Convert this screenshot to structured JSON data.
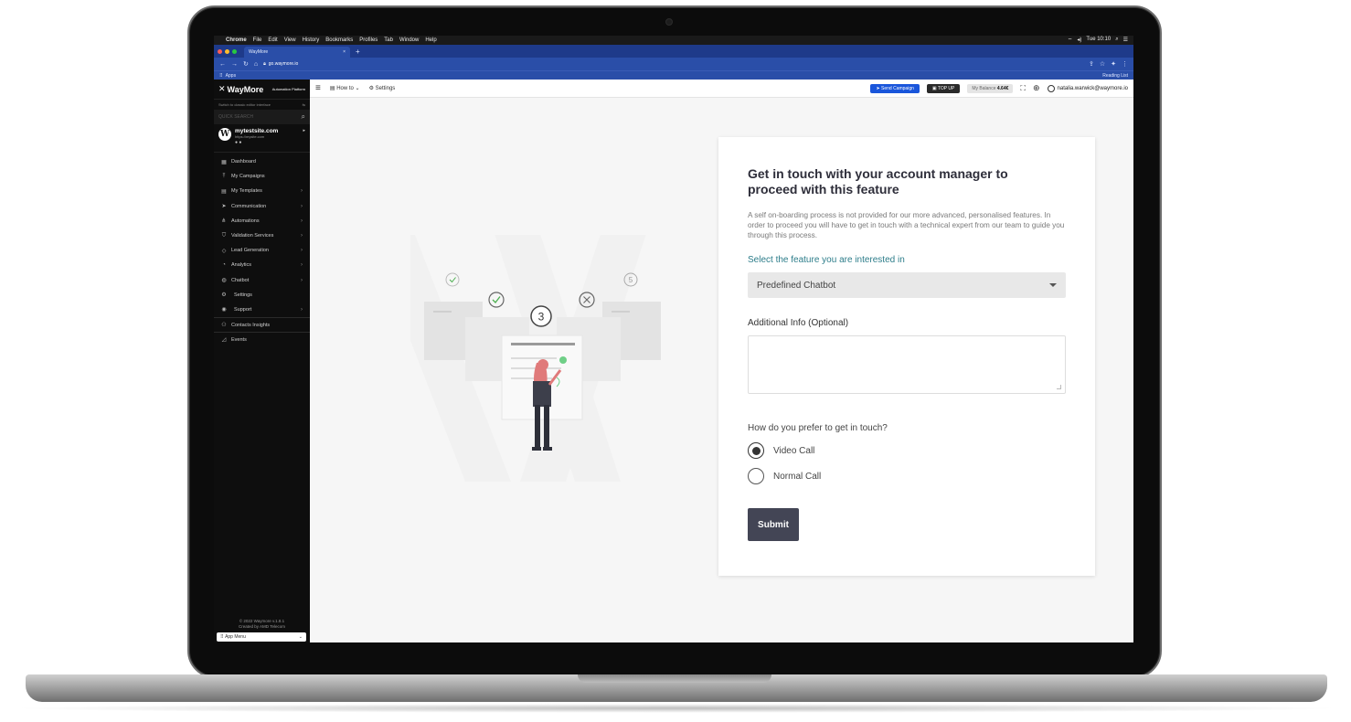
{
  "menubar": {
    "items": [
      "Chrome",
      "File",
      "Edit",
      "View",
      "History",
      "Bookmarks",
      "Profiles",
      "Tab",
      "Window",
      "Help"
    ],
    "clock": "Tue 10:10"
  },
  "browser": {
    "tab_title": "WayMore",
    "url": "go.waymore.io",
    "bookmarks_apps": "Apps",
    "reading_list": "Reading List"
  },
  "sidebar": {
    "brand": "WayMore",
    "brand_sub": "Automation Platform",
    "switch_text": "Switch to classic editor interface",
    "quick_search": "QUICK SEARCH",
    "site_name": "mytestsite.com",
    "site_url": "https://mysite.com",
    "items": [
      {
        "label": "Dashboard",
        "icon": "dashboard-icon"
      },
      {
        "label": "My Campaigns",
        "icon": "upload-icon"
      },
      {
        "label": "My Templates",
        "icon": "templates-icon"
      },
      {
        "label": "Communication",
        "icon": "send-icon"
      },
      {
        "label": "Automations",
        "icon": "automation-icon"
      },
      {
        "label": "Validation Services",
        "icon": "shield-icon"
      },
      {
        "label": "Lead Generation",
        "icon": "tag-icon"
      },
      {
        "label": "Analytics",
        "icon": "pie-icon"
      },
      {
        "label": "Chatbot",
        "icon": "chatbot-icon"
      },
      {
        "label": "Settings",
        "icon": "gear-icon"
      },
      {
        "label": "Support",
        "icon": "support-icon"
      },
      {
        "label": "Contacts Insights",
        "icon": "contacts-icon"
      },
      {
        "label": "Events",
        "icon": "events-icon"
      }
    ],
    "footer_line1": "© 2022 Waymore v.1.8.1",
    "footer_line2": "Created by AMD Telecom",
    "app_menu": "App Menu"
  },
  "topbar": {
    "howto": "How to",
    "settings": "Settings",
    "send_campaign": "Send Campaign",
    "top_up": "TOP UP",
    "balance_label": "My Balance",
    "balance_value": "4.64€",
    "user_email": "natalia.warwick@waymore.io"
  },
  "illustration": {
    "step_number": "3",
    "step_far_right": "5"
  },
  "form": {
    "title": "Get in touch with your account manager to proceed with this feature",
    "description": "A self on-boarding process is not provided for our more advanced, personalised features. In order to proceed you will have to get in touch with a technical expert from our team to guide you through this process.",
    "feature_label": "Select the feature you are interested in",
    "feature_selected": "Predefined Chatbot",
    "additional_label": "Additional Info (Optional)",
    "contact_question": "How do you prefer to get in touch?",
    "option_video": "Video Call",
    "option_normal": "Normal Call",
    "submit_label": "Submit",
    "selected_option": "Video Call"
  },
  "colors": {
    "accent_blue": "#1a56db",
    "teal_label": "#2d7d8a",
    "submit_bg": "#434555",
    "chrome_blue": "#1e3a8a"
  }
}
